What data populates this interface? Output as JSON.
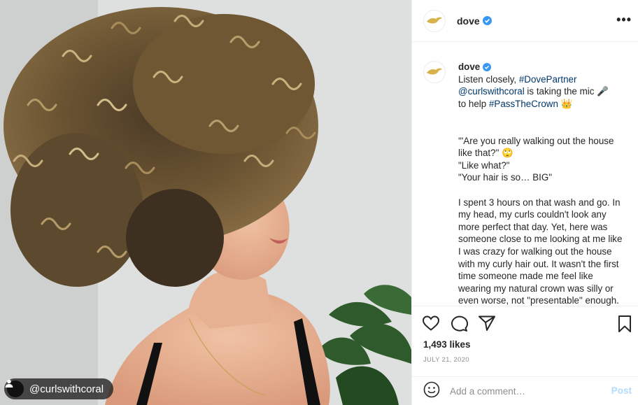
{
  "photo": {
    "tag_username": "@curlswithcoral"
  },
  "header": {
    "username": "dove"
  },
  "caption": {
    "username": "dove",
    "lines": [
      "Listen closely, ",
      "#DovePartner",
      "@curlswithcoral",
      " is taking the mic 🎤",
      "to help ",
      "#PassTheCrown",
      " 👑"
    ],
    "quote1": "'\"Are you really walking out the house like that?\" 🙄",
    "quote2": "\"Like what?\"",
    "quote3": "\"Your hair is so… BIG\"",
    "paragraph": "I spent 3 hours on that wash and go. In my head, my curls couldn't look any more perfect that day. Yet, here was someone close to me looking at me like I was crazy for walking out the house with my curly hair out. It wasn't the first time someone made me feel like wearing my natural crown was silly or even worse, not \"presentable\" enough. There have been SO MANY"
  },
  "actions": {
    "likes": "1,493 likes",
    "date": "JULY 21, 2020"
  },
  "comment": {
    "placeholder": "Add a comment…",
    "post_label": "Post"
  },
  "colors": {
    "link": "#00376b",
    "verified": "#3897f0",
    "post_disabled": "#b3dbff",
    "muted": "#8e8e8e"
  },
  "icons": [
    "heart-icon",
    "comment-icon",
    "share-icon",
    "bookmark-icon",
    "more-icon",
    "verified-badge-icon",
    "emoji-icon",
    "person-icon",
    "dove-logo-icon"
  ]
}
